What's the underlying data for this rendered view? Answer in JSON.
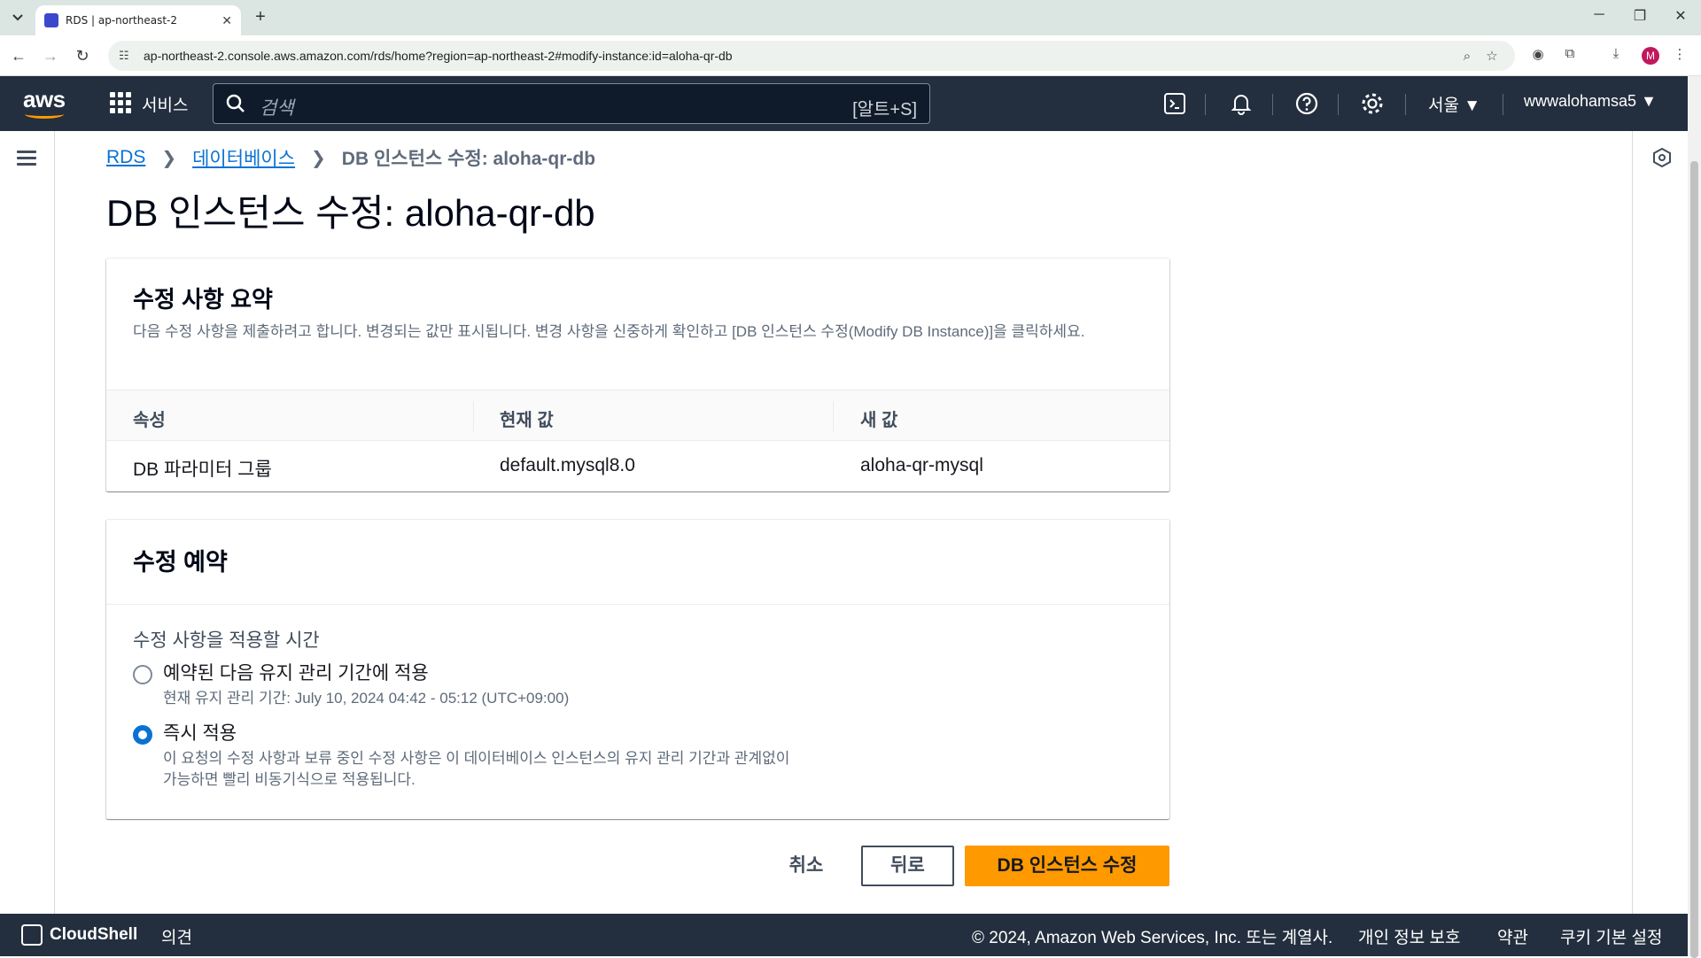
{
  "browser": {
    "tab_title": "RDS | ap-northeast-2",
    "url": "ap-northeast-2.console.aws.amazon.com/rds/home?region=ap-northeast-2#modify-instance:id=aloha-qr-db",
    "profile_initial": "M"
  },
  "aws_nav": {
    "services_label": "서비스",
    "search_placeholder": "검색",
    "search_shortcut": "[알트+S]",
    "region": "서울",
    "account": "wwwalohamsa5"
  },
  "breadcrumb": {
    "root": "RDS",
    "parent": "데이터베이스",
    "current": "DB 인스턴스 수정: aloha-qr-db"
  },
  "page_title": "DB 인스턴스 수정: aloha-qr-db",
  "summary": {
    "title": "수정 사항 요약",
    "description": "다음 수정 사항을 제출하려고 합니다. 변경되는 값만 표시됩니다. 변경 사항을 신중하게 확인하고 [DB 인스턴스 수정(Modify DB Instance)]을 클릭하세요.",
    "columns": [
      "속성",
      "현재 값",
      "새 값"
    ],
    "rows": [
      {
        "attribute": "DB 파라미터 그룹",
        "current": "default.mysql8.0",
        "new": "aloha-qr-mysql"
      }
    ]
  },
  "schedule": {
    "title": "수정 예약",
    "field_label": "수정 사항을 적용할 시간",
    "options": [
      {
        "label": "예약된 다음 유지 관리 기간에 적용",
        "description": "현재 유지 관리 기간: July 10, 2024 04:42 - 05:12 (UTC+09:00)",
        "selected": false
      },
      {
        "label": "즉시 적용",
        "description_line1": "이 요청의 수정 사항과 보류 중인 수정 사항은 이 데이터베이스 인스턴스의 유지 관리 기간과 관계없이",
        "description_line2": "가능하면 빨리 비동기식으로 적용됩니다.",
        "selected": true
      }
    ]
  },
  "actions": {
    "cancel": "취소",
    "back": "뒤로",
    "submit": "DB 인스턴스 수정"
  },
  "footer": {
    "cloudshell": "CloudShell",
    "feedback": "의견",
    "copyright": "© 2024, Amazon Web Services, Inc. 또는 계열사.",
    "privacy": "개인 정보 보호",
    "terms": "약관",
    "cookies": "쿠키 기본 설정"
  },
  "colors": {
    "nav_bg": "#232f3e",
    "primary_button": "#ff9900",
    "link": "#0972d3"
  }
}
